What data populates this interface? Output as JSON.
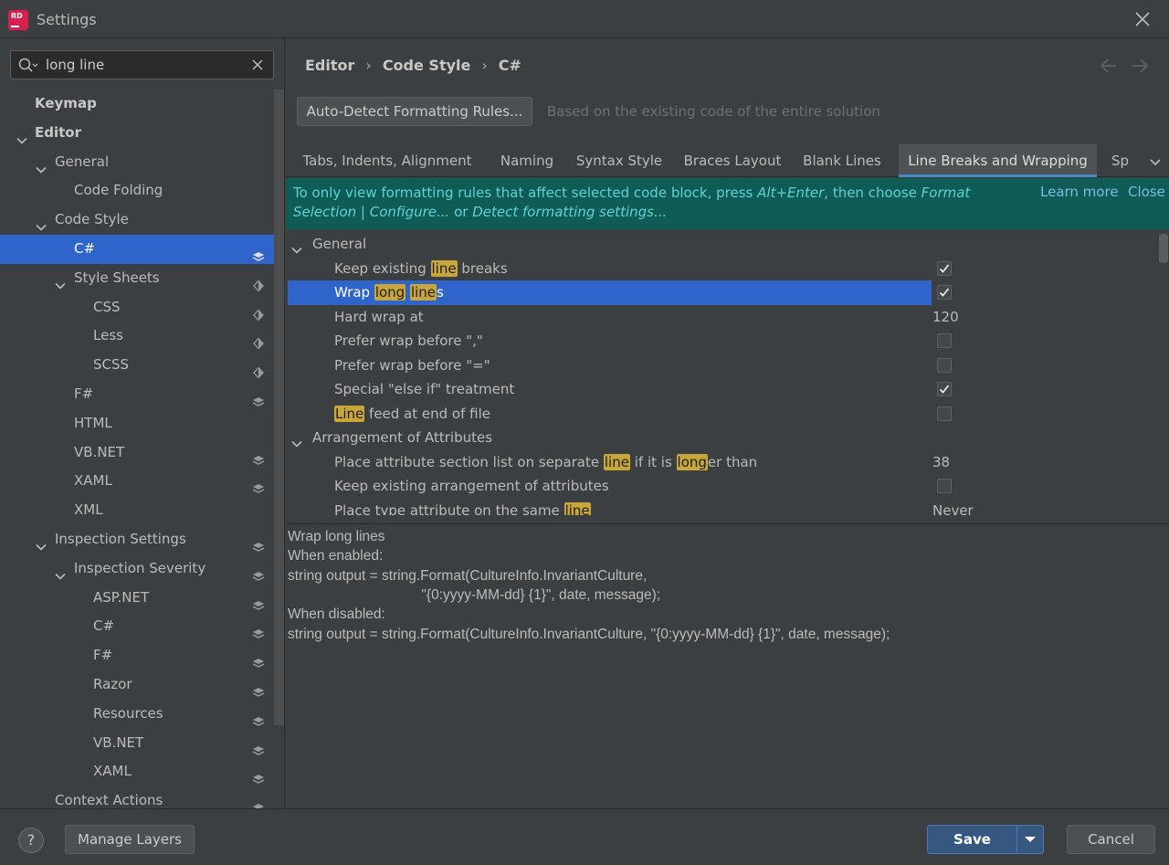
{
  "window": {
    "title": "Settings",
    "app_icon_text_1": "RD",
    "app_icon_text_2": ""
  },
  "search": {
    "value": "long line"
  },
  "tree": [
    {
      "label": "Keymap",
      "level": 0,
      "bold": true,
      "chevron": "none",
      "layer": "none"
    },
    {
      "label": "Editor",
      "level": 0,
      "bold": true,
      "chevron": "down",
      "layer": "none"
    },
    {
      "label": "General",
      "level": 1,
      "bold": false,
      "chevron": "down",
      "layer": "none"
    },
    {
      "label": "Code Folding",
      "level": 2,
      "bold": false,
      "chevron": "none",
      "layer": "none"
    },
    {
      "label": "Code Style",
      "level": 1,
      "bold": false,
      "chevron": "down",
      "layer": "none"
    },
    {
      "label": "C#",
      "level": 2,
      "bold": false,
      "chevron": "none",
      "layer": "stack",
      "selected": true
    },
    {
      "label": "Style Sheets",
      "level": 2,
      "bold": false,
      "chevron": "down",
      "layer": "diamond"
    },
    {
      "label": "CSS",
      "level": 3,
      "bold": false,
      "chevron": "none",
      "layer": "diamond"
    },
    {
      "label": "Less",
      "level": 3,
      "bold": false,
      "chevron": "none",
      "layer": "diamond"
    },
    {
      "label": "SCSS",
      "level": 3,
      "bold": false,
      "chevron": "none",
      "layer": "diamond"
    },
    {
      "label": "F#",
      "level": 2,
      "bold": false,
      "chevron": "none",
      "layer": "stack"
    },
    {
      "label": "HTML",
      "level": 2,
      "bold": false,
      "chevron": "none",
      "layer": "none"
    },
    {
      "label": "VB.NET",
      "level": 2,
      "bold": false,
      "chevron": "none",
      "layer": "stack"
    },
    {
      "label": "XAML",
      "level": 2,
      "bold": false,
      "chevron": "none",
      "layer": "stack"
    },
    {
      "label": "XML",
      "level": 2,
      "bold": false,
      "chevron": "none",
      "layer": "none"
    },
    {
      "label": "Inspection Settings",
      "level": 1,
      "bold": false,
      "chevron": "down",
      "layer": "stack"
    },
    {
      "label": "Inspection Severity",
      "level": 2,
      "bold": false,
      "chevron": "down",
      "layer": "stack"
    },
    {
      "label": "ASP.NET",
      "level": 3,
      "bold": false,
      "chevron": "none",
      "layer": "stack"
    },
    {
      "label": "C#",
      "level": 3,
      "bold": false,
      "chevron": "none",
      "layer": "stack"
    },
    {
      "label": "F#",
      "level": 3,
      "bold": false,
      "chevron": "none",
      "layer": "stack"
    },
    {
      "label": "Razor",
      "level": 3,
      "bold": false,
      "chevron": "none",
      "layer": "stack"
    },
    {
      "label": "Resources",
      "level": 3,
      "bold": false,
      "chevron": "none",
      "layer": "stack"
    },
    {
      "label": "VB.NET",
      "level": 3,
      "bold": false,
      "chevron": "none",
      "layer": "stack"
    },
    {
      "label": "XAML",
      "level": 3,
      "bold": false,
      "chevron": "none",
      "layer": "stack"
    },
    {
      "label": "Context Actions",
      "level": 1,
      "bold": false,
      "chevron": "none",
      "layer": "stack"
    }
  ],
  "breadcrumb": {
    "items": [
      "Editor",
      "Code Style",
      "C#"
    ],
    "separator": "›"
  },
  "auto_detect": {
    "button_label": "Auto-Detect Formatting Rules...",
    "hint": "Based on the existing code of the entire solution"
  },
  "tabs": [
    {
      "label": "Tabs, Indents, Alignment",
      "active": false
    },
    {
      "label": "Naming",
      "active": false
    },
    {
      "label": "Syntax Style",
      "active": false
    },
    {
      "label": "Braces Layout",
      "active": false
    },
    {
      "label": "Blank Lines",
      "active": false
    },
    {
      "label": "Line Breaks and Wrapping",
      "active": true
    },
    {
      "label": "Sp",
      "active": false
    }
  ],
  "banner": {
    "text_1": "To only view formatting rules that affect selected code block, press ",
    "shortcut": "Alt+Enter",
    "text_2": ", then choose ",
    "format_selection": "Format Selection",
    "text_3": " | ",
    "configure": "Configure...",
    "text_4": " or ",
    "detect": "Detect formatting settings...",
    "learn_more": "Learn more",
    "close": "Close"
  },
  "options": [
    {
      "type": "group",
      "label": "General"
    },
    {
      "type": "check",
      "parts": [
        [
          "Keep existing ",
          false
        ],
        [
          "line",
          true
        ],
        [
          " breaks",
          false
        ]
      ],
      "checked": true
    },
    {
      "type": "check",
      "parts": [
        [
          "Wrap ",
          false
        ],
        [
          "long",
          true
        ],
        [
          " ",
          false
        ],
        [
          "line",
          true
        ],
        [
          "s",
          false
        ]
      ],
      "checked": true,
      "selected": true
    },
    {
      "type": "value",
      "parts": [
        [
          "Hard wrap at",
          false
        ]
      ],
      "value": "120"
    },
    {
      "type": "check",
      "parts": [
        [
          "Prefer wrap before \",\"",
          false
        ]
      ],
      "checked": false
    },
    {
      "type": "check",
      "parts": [
        [
          "Prefer wrap before \"=\"",
          false
        ]
      ],
      "checked": false
    },
    {
      "type": "check",
      "parts": [
        [
          "Special \"else if\" treatment",
          false
        ]
      ],
      "checked": true
    },
    {
      "type": "check",
      "parts": [
        [
          "Line",
          true
        ],
        [
          " feed at end of file",
          false
        ]
      ],
      "checked": false
    },
    {
      "type": "group",
      "label": "Arrangement of Attributes"
    },
    {
      "type": "value",
      "parts": [
        [
          "Place attribute section list on separate ",
          false
        ],
        [
          "line",
          true
        ],
        [
          " if it is ",
          false
        ],
        [
          "long",
          true
        ],
        [
          "er than",
          false
        ]
      ],
      "value": "38"
    },
    {
      "type": "check",
      "parts": [
        [
          "Keep existing arrangement of attributes",
          false
        ]
      ],
      "checked": false
    },
    {
      "type": "dropdown",
      "parts": [
        [
          "Place type attribute on the same ",
          false
        ],
        [
          "line",
          true
        ]
      ],
      "value": "Never"
    }
  ],
  "preview": {
    "lines": [
      "Wrap long lines",
      "When enabled:",
      "string output = string.Format(CultureInfo.InvariantCulture,",
      "                                  \"{0:yyyy-MM-dd} {1}\", date, message);",
      "When disabled:",
      "string output = string.Format(CultureInfo.InvariantCulture, \"{0:yyyy-MM-dd} {1}\", date, message);"
    ]
  },
  "footer": {
    "help": "?",
    "manage_layers": "Manage Layers",
    "save": "Save",
    "cancel": "Cancel"
  },
  "colors": {
    "selection": "#2f65ca",
    "banner_bg": "#0f5b55",
    "banner_text": "#5fd3d6",
    "highlight": "#c9a63a",
    "save_bg": "#365880"
  }
}
